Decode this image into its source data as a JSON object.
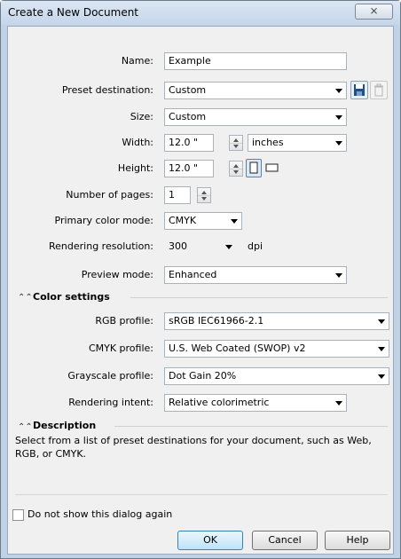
{
  "window": {
    "title": "Create a New Document",
    "close_glyph": "⨯"
  },
  "fields": {
    "name": {
      "label": "Name:",
      "value": "Example"
    },
    "preset_destination": {
      "label": "Preset destination:",
      "value": "Custom"
    },
    "size": {
      "label": "Size:",
      "value": "Custom"
    },
    "width": {
      "label": "Width:",
      "value": "12.0 \"",
      "unit": "inches"
    },
    "height": {
      "label": "Height:",
      "value": "12.0 \""
    },
    "pages": {
      "label": "Number of pages:",
      "value": "1"
    },
    "color_mode": {
      "label": "Primary color mode:",
      "value": "CMYK"
    },
    "resolution": {
      "label": "Rendering resolution:",
      "value": "300",
      "unit": "dpi"
    },
    "preview_mode": {
      "label": "Preview mode:",
      "value": "Enhanced"
    }
  },
  "color_settings": {
    "header": "Color settings",
    "rgb_profile": {
      "label": "RGB profile:",
      "value": "sRGB IEC61966-2.1"
    },
    "cmyk_profile": {
      "label": "CMYK profile:",
      "value": "U.S. Web Coated (SWOP) v2"
    },
    "grayscale_profile": {
      "label": "Grayscale profile:",
      "value": "Dot Gain 20%"
    },
    "rendering_intent": {
      "label": "Rendering intent:",
      "value": "Relative colorimetric"
    }
  },
  "description": {
    "header": "Description",
    "text": "Select from a list of preset destinations for your document, such as Web, RGB, or CMYK."
  },
  "footer": {
    "checkbox_label": "Do not show this dialog again",
    "checkbox_checked": false,
    "ok_label": "OK",
    "cancel_label": "Cancel",
    "help_label": "Help"
  },
  "icons": {
    "save_preset": "save-icon",
    "delete_preset": "trash-icon",
    "portrait": "portrait-icon",
    "landscape": "landscape-icon",
    "collapse": "double-chevron-up-icon"
  },
  "colors": {
    "accent": "#3c7fb1",
    "title_bar": "#c5d6ea",
    "panel": "#f0f0f0"
  }
}
